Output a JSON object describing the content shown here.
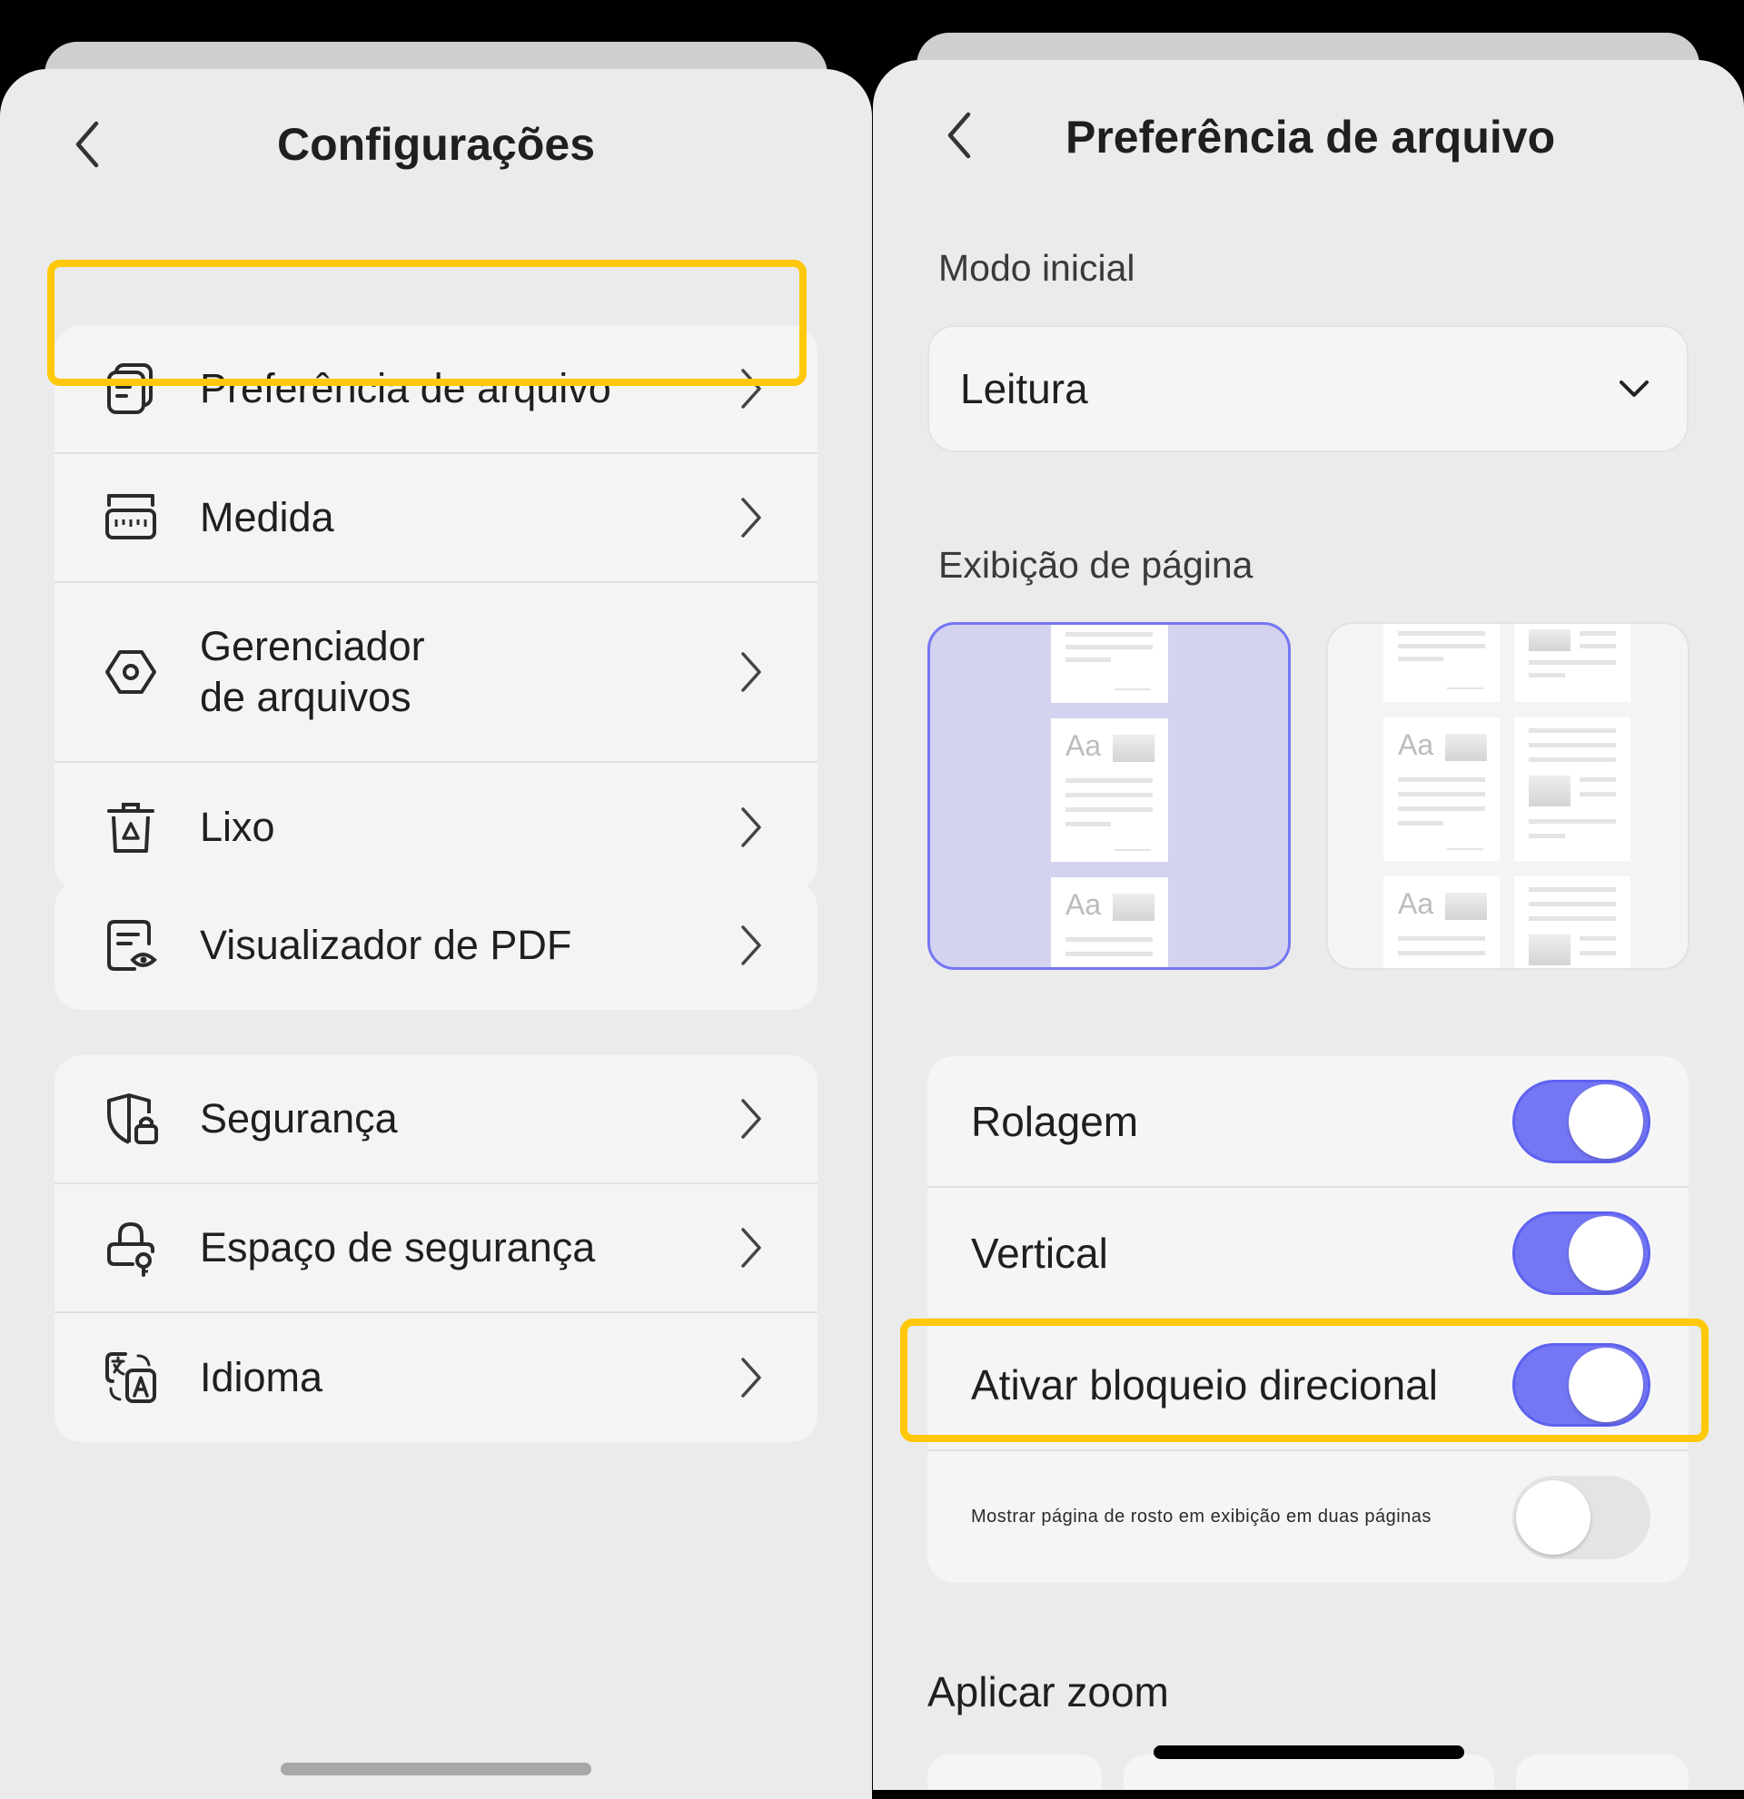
{
  "left": {
    "title": "Configurações",
    "groups": [
      [
        {
          "label": "Preferência de arquivo",
          "icon": "files-icon"
        },
        {
          "label": "Medida",
          "icon": "ruler-icon"
        },
        {
          "label": "Gerenciador\nde arquivos",
          "icon": "hexagon-icon"
        },
        {
          "label": "Lixo",
          "icon": "trash-icon"
        }
      ],
      [
        {
          "label": "Visualizador de PDF",
          "icon": "pdf-viewer-icon"
        }
      ],
      [
        {
          "label": "Segurança",
          "icon": "shield-lock-icon"
        },
        {
          "label": "Espaço de segurança",
          "icon": "lock-key-icon"
        },
        {
          "label": "Idioma",
          "icon": "language-icon"
        }
      ]
    ]
  },
  "right": {
    "title": "Preferência de arquivo",
    "initial_mode_label": "Modo inicial",
    "initial_mode_value": "Leitura",
    "page_display_label": "Exibição de página",
    "thumb_text": "Aa",
    "toggles": [
      {
        "label": "Rolagem",
        "on": true
      },
      {
        "label": "Vertical",
        "on": true
      },
      {
        "label": "Ativar bloqueio direcional",
        "on": true
      },
      {
        "label": "Mostrar página de rosto em exibição em duas páginas",
        "on": false
      }
    ],
    "zoom_label": "Aplicar zoom"
  },
  "colors": {
    "accent": "#7476f4",
    "highlight": "#ffc80a",
    "background": "#ebebeb"
  }
}
